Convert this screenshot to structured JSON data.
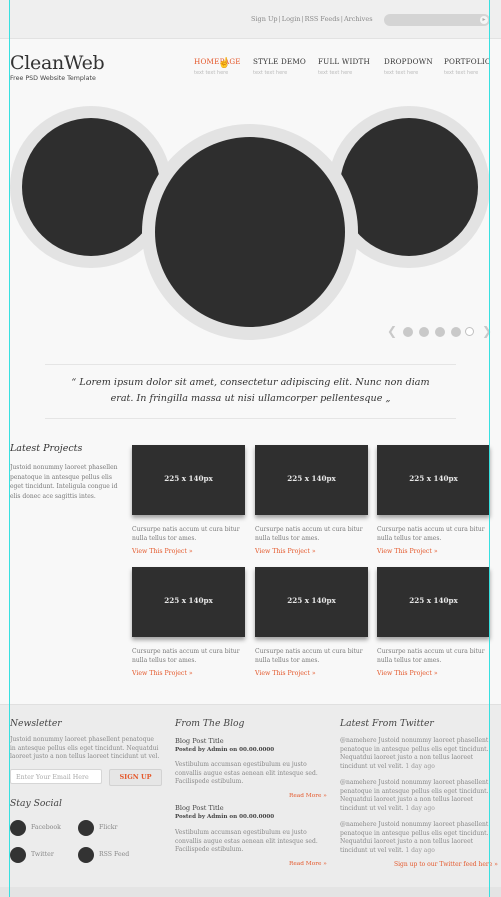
{
  "topbar": {
    "links": [
      "Sign Up",
      "Login",
      "RSS Feeds",
      "Archives"
    ],
    "search_icon": "arrow-right-icon"
  },
  "header": {
    "logo": "CleanWeb",
    "tagline": "Free PSD Website Template",
    "nav": [
      {
        "label": "HOMEPAGE",
        "sub": "text text here",
        "active": true
      },
      {
        "label": "STYLE DEMO",
        "sub": "text text here",
        "active": false
      },
      {
        "label": "FULL WIDTH",
        "sub": "text text here",
        "active": false
      },
      {
        "label": "DROPDOWN",
        "sub": "text text here",
        "active": false
      },
      {
        "label": "PORTFOLIO",
        "sub": "text text here",
        "active": false
      }
    ]
  },
  "slider": {
    "prev_icon": "chevron-left-icon",
    "next_icon": "chevron-right-icon",
    "dots": 5,
    "active_dot": 5
  },
  "quote": "“ Lorem ipsum dolor sit amet, consectetur adipiscing elit. Nunc non diam erat. In fringilla massa ut nisi ullamcorper pellentesque „",
  "latest_projects": {
    "title": "Latest Projects",
    "description": "Justoid nonummy laoreet phasellen penatoque in antesque pellus elis eget tincidunt. Inteligula congue id elis donec ace sagittis intes.",
    "items": [
      {
        "thumb": "225 x 140px",
        "text": "Cursurpe natis accum ut cura bitur nulla tellus tor ames.",
        "link": "View This Project »"
      },
      {
        "thumb": "225 x 140px",
        "text": "Cursurpe natis accum ut cura bitur nulla tellus tor ames.",
        "link": "View This Project »"
      },
      {
        "thumb": "225 x 140px",
        "text": "Cursurpe natis accum ut cura bitur nulla tellus tor ames.",
        "link": "View This Project »"
      },
      {
        "thumb": "225 x 140px",
        "text": "Cursurpe natis accum ut cura bitur nulla tellus tor ames.",
        "link": "View This Project »"
      },
      {
        "thumb": "225 x 140px",
        "text": "Cursurpe natis accum ut cura bitur nulla tellus tor ames.",
        "link": "View This Project »"
      },
      {
        "thumb": "225 x 140px",
        "text": "Cursurpe natis accum ut cura bitur nulla tellus tor ames.",
        "link": "View This Project »"
      }
    ]
  },
  "footer": {
    "newsletter": {
      "title": "Newsletter",
      "text": "Justoid nonummy laoreet phasellent penatoque in antesque pellus elis eget tincidunt. Nequatdui laoreet justo a non tellus laoreet tincidunt ut vel.",
      "email_placeholder": "Enter Your Email Here",
      "signup_label": "SIGN UP"
    },
    "social": {
      "title": "Stay Social",
      "items": [
        {
          "label": "Facebook",
          "icon": "facebook-icon"
        },
        {
          "label": "Flickr",
          "icon": "flickr-icon"
        },
        {
          "label": "Twitter",
          "icon": "twitter-icon"
        },
        {
          "label": "RSS Feed",
          "icon": "rss-icon"
        }
      ]
    },
    "blog": {
      "title": "From The Blog",
      "posts": [
        {
          "title": "Blog Post Title",
          "meta": "Posted by Admin on 00.00.0000",
          "text": "Vestibulum accumsan egestibulum eu justo convallis augue estas aenean elit intesque sed. Facilispede estibulum.",
          "more": "Read More »"
        },
        {
          "title": "Blog Post Title",
          "meta": "Posted by Admin on 00.00.0000",
          "text": "Vestibulum accumsan egestibulum eu justo convallis augue estas aenean elit intesque sed. Facilispede estibulum.",
          "more": "Read More »"
        }
      ]
    },
    "twitter": {
      "title": "Latest From Twitter",
      "tweets": [
        {
          "text": "@namehere Justoid nonummy laoreet phasellent penatoque in antesque pellus elis eget tincidunt. Nequatdui laoreet justo a non tellus laoreet tincidunt ut vel velit.",
          "time": "1 day ago"
        },
        {
          "text": "@namehere Justoid nonummy laoreet phasellent penatoque in antesque pellus elis eget tincidunt. Nequatdui laoreet justo a non tellus laoreet tincidunt ut vel velit.",
          "time": "1 day ago"
        },
        {
          "text": "@namehere Justoid nonummy laoreet phasellent penatoque in antesque pellus elis eget tincidunt. Nequatdui laoreet justo a non tellus laoreet tincidunt ut vel velit.",
          "time": "1 day ago"
        }
      ],
      "follow_link": "Sign up to our Twitter feed here »"
    }
  },
  "colors": {
    "accent": "#e4582b",
    "dark": "#2e2e2e",
    "guide": "#38e0e0"
  }
}
